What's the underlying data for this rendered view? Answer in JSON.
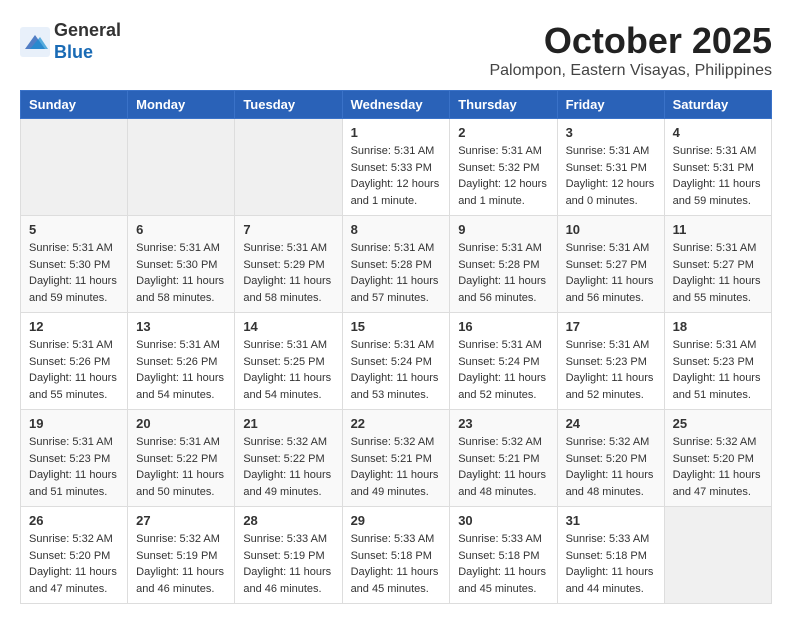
{
  "header": {
    "logo_line1": "General",
    "logo_line2": "Blue",
    "month_title": "October 2025",
    "subtitle": "Palompon, Eastern Visayas, Philippines"
  },
  "weekdays": [
    "Sunday",
    "Monday",
    "Tuesday",
    "Wednesday",
    "Thursday",
    "Friday",
    "Saturday"
  ],
  "weeks": [
    [
      {
        "day": "",
        "info": ""
      },
      {
        "day": "",
        "info": ""
      },
      {
        "day": "",
        "info": ""
      },
      {
        "day": "1",
        "info": "Sunrise: 5:31 AM\nSunset: 5:33 PM\nDaylight: 12 hours\nand 1 minute."
      },
      {
        "day": "2",
        "info": "Sunrise: 5:31 AM\nSunset: 5:32 PM\nDaylight: 12 hours\nand 1 minute."
      },
      {
        "day": "3",
        "info": "Sunrise: 5:31 AM\nSunset: 5:31 PM\nDaylight: 12 hours\nand 0 minutes."
      },
      {
        "day": "4",
        "info": "Sunrise: 5:31 AM\nSunset: 5:31 PM\nDaylight: 11 hours\nand 59 minutes."
      }
    ],
    [
      {
        "day": "5",
        "info": "Sunrise: 5:31 AM\nSunset: 5:30 PM\nDaylight: 11 hours\nand 59 minutes."
      },
      {
        "day": "6",
        "info": "Sunrise: 5:31 AM\nSunset: 5:30 PM\nDaylight: 11 hours\nand 58 minutes."
      },
      {
        "day": "7",
        "info": "Sunrise: 5:31 AM\nSunset: 5:29 PM\nDaylight: 11 hours\nand 58 minutes."
      },
      {
        "day": "8",
        "info": "Sunrise: 5:31 AM\nSunset: 5:28 PM\nDaylight: 11 hours\nand 57 minutes."
      },
      {
        "day": "9",
        "info": "Sunrise: 5:31 AM\nSunset: 5:28 PM\nDaylight: 11 hours\nand 56 minutes."
      },
      {
        "day": "10",
        "info": "Sunrise: 5:31 AM\nSunset: 5:27 PM\nDaylight: 11 hours\nand 56 minutes."
      },
      {
        "day": "11",
        "info": "Sunrise: 5:31 AM\nSunset: 5:27 PM\nDaylight: 11 hours\nand 55 minutes."
      }
    ],
    [
      {
        "day": "12",
        "info": "Sunrise: 5:31 AM\nSunset: 5:26 PM\nDaylight: 11 hours\nand 55 minutes."
      },
      {
        "day": "13",
        "info": "Sunrise: 5:31 AM\nSunset: 5:26 PM\nDaylight: 11 hours\nand 54 minutes."
      },
      {
        "day": "14",
        "info": "Sunrise: 5:31 AM\nSunset: 5:25 PM\nDaylight: 11 hours\nand 54 minutes."
      },
      {
        "day": "15",
        "info": "Sunrise: 5:31 AM\nSunset: 5:24 PM\nDaylight: 11 hours\nand 53 minutes."
      },
      {
        "day": "16",
        "info": "Sunrise: 5:31 AM\nSunset: 5:24 PM\nDaylight: 11 hours\nand 52 minutes."
      },
      {
        "day": "17",
        "info": "Sunrise: 5:31 AM\nSunset: 5:23 PM\nDaylight: 11 hours\nand 52 minutes."
      },
      {
        "day": "18",
        "info": "Sunrise: 5:31 AM\nSunset: 5:23 PM\nDaylight: 11 hours\nand 51 minutes."
      }
    ],
    [
      {
        "day": "19",
        "info": "Sunrise: 5:31 AM\nSunset: 5:23 PM\nDaylight: 11 hours\nand 51 minutes."
      },
      {
        "day": "20",
        "info": "Sunrise: 5:31 AM\nSunset: 5:22 PM\nDaylight: 11 hours\nand 50 minutes."
      },
      {
        "day": "21",
        "info": "Sunrise: 5:32 AM\nSunset: 5:22 PM\nDaylight: 11 hours\nand 49 minutes."
      },
      {
        "day": "22",
        "info": "Sunrise: 5:32 AM\nSunset: 5:21 PM\nDaylight: 11 hours\nand 49 minutes."
      },
      {
        "day": "23",
        "info": "Sunrise: 5:32 AM\nSunset: 5:21 PM\nDaylight: 11 hours\nand 48 minutes."
      },
      {
        "day": "24",
        "info": "Sunrise: 5:32 AM\nSunset: 5:20 PM\nDaylight: 11 hours\nand 48 minutes."
      },
      {
        "day": "25",
        "info": "Sunrise: 5:32 AM\nSunset: 5:20 PM\nDaylight: 11 hours\nand 47 minutes."
      }
    ],
    [
      {
        "day": "26",
        "info": "Sunrise: 5:32 AM\nSunset: 5:20 PM\nDaylight: 11 hours\nand 47 minutes."
      },
      {
        "day": "27",
        "info": "Sunrise: 5:32 AM\nSunset: 5:19 PM\nDaylight: 11 hours\nand 46 minutes."
      },
      {
        "day": "28",
        "info": "Sunrise: 5:33 AM\nSunset: 5:19 PM\nDaylight: 11 hours\nand 46 minutes."
      },
      {
        "day": "29",
        "info": "Sunrise: 5:33 AM\nSunset: 5:18 PM\nDaylight: 11 hours\nand 45 minutes."
      },
      {
        "day": "30",
        "info": "Sunrise: 5:33 AM\nSunset: 5:18 PM\nDaylight: 11 hours\nand 45 minutes."
      },
      {
        "day": "31",
        "info": "Sunrise: 5:33 AM\nSunset: 5:18 PM\nDaylight: 11 hours\nand 44 minutes."
      },
      {
        "day": "",
        "info": ""
      }
    ]
  ]
}
